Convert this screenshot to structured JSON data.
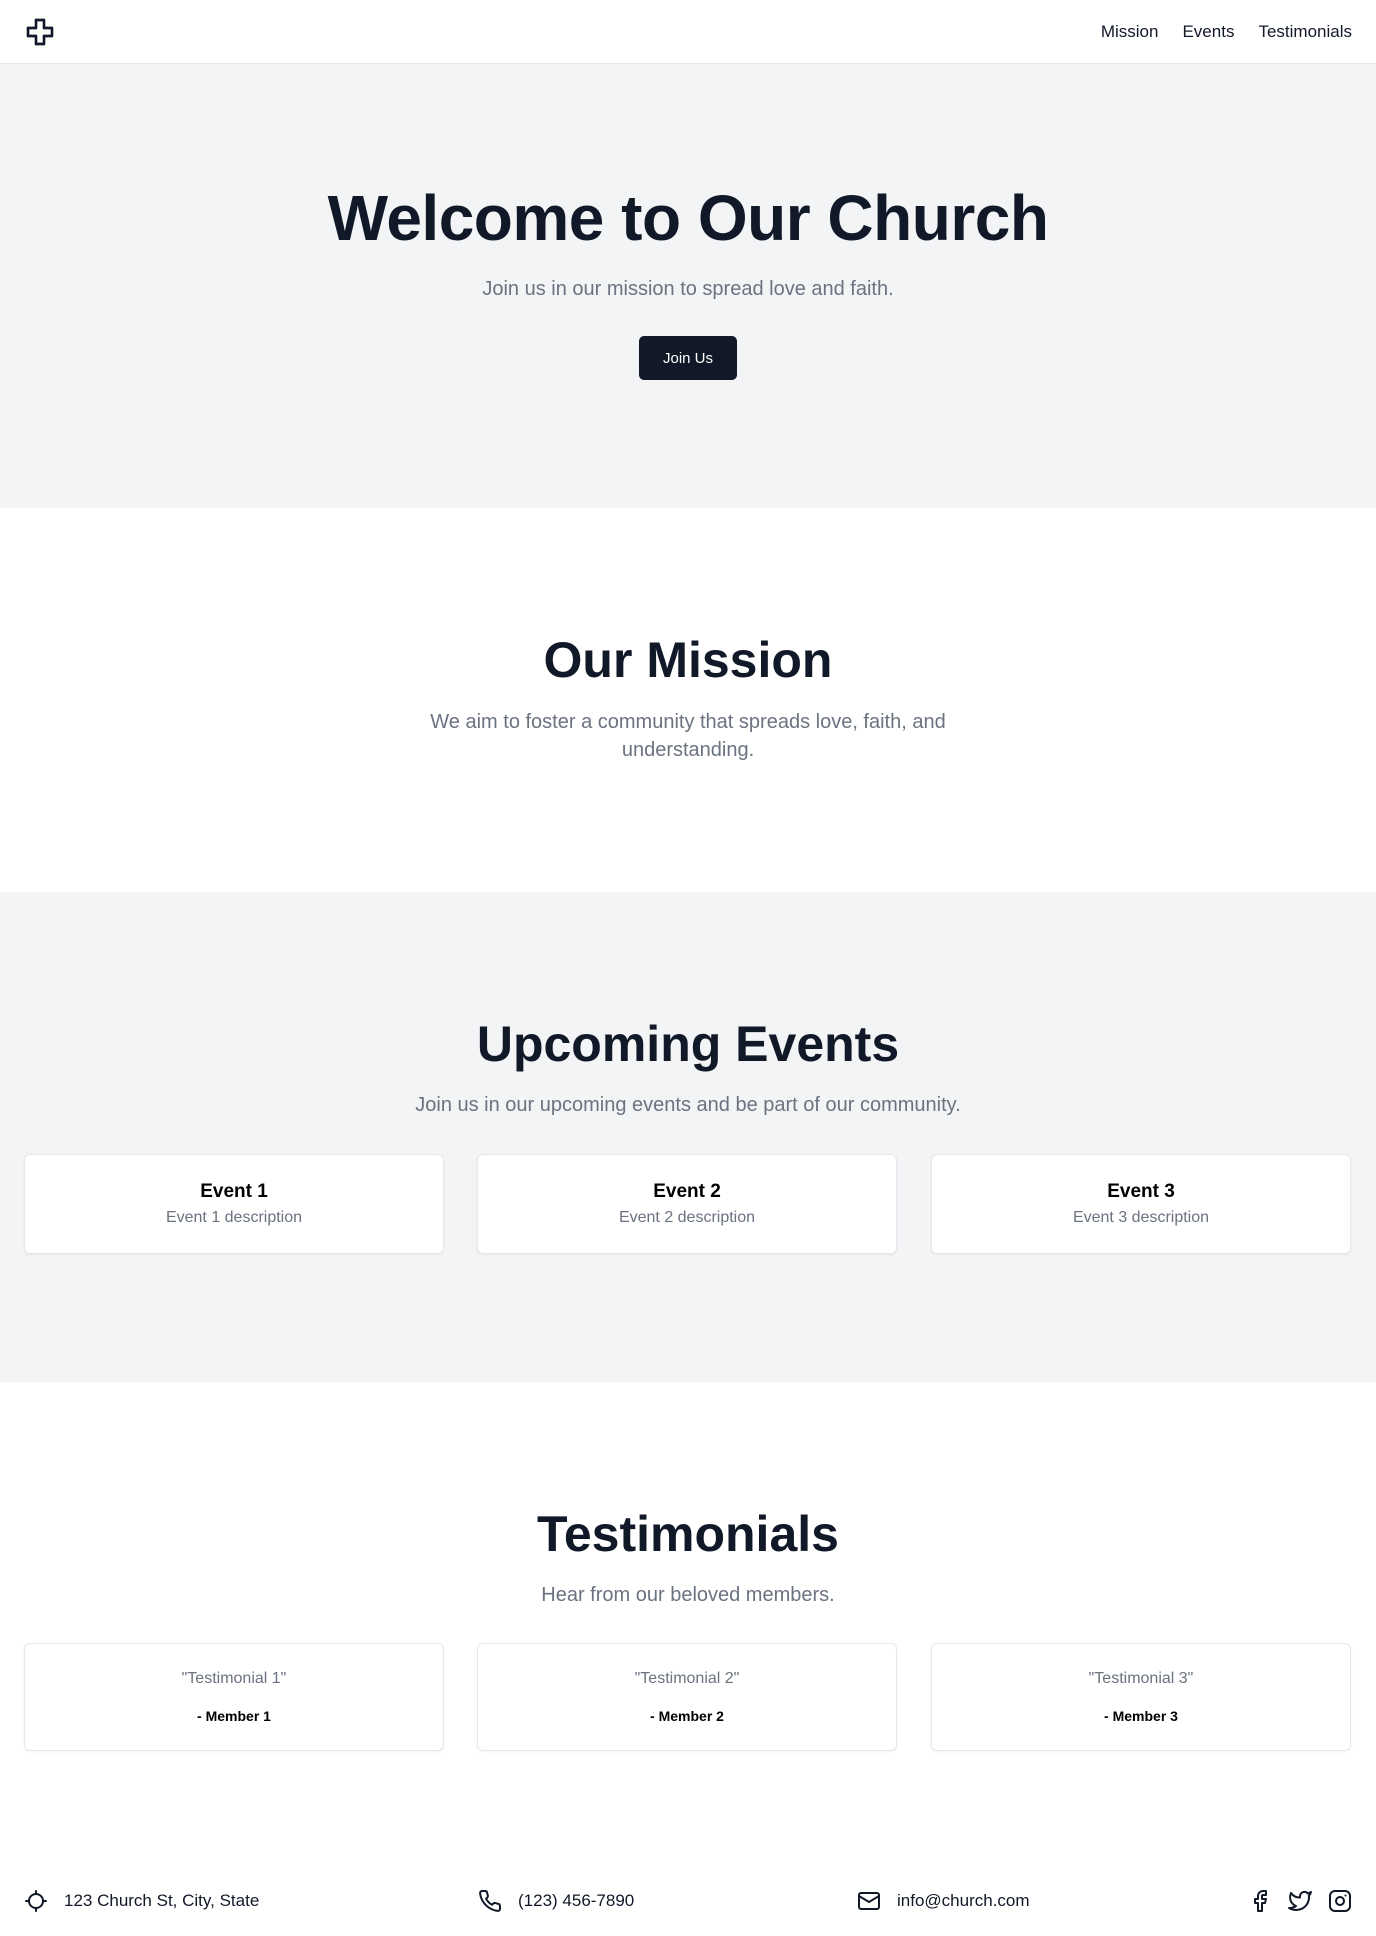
{
  "header": {
    "logo_icon": "cross-icon",
    "nav": [
      {
        "label": "Mission"
      },
      {
        "label": "Events"
      },
      {
        "label": "Testimonials"
      }
    ]
  },
  "hero": {
    "title": "Welcome to Our Church",
    "subtitle": "Join us in our mission to spread love and faith.",
    "button_label": "Join Us"
  },
  "mission": {
    "title": "Our Mission",
    "text": "We aim to foster a community that spreads love, faith, and understanding."
  },
  "events": {
    "title": "Upcoming Events",
    "subtitle": "Join us in our upcoming events and be part of our community.",
    "items": [
      {
        "title": "Event 1",
        "description": "Event 1 description"
      },
      {
        "title": "Event 2",
        "description": "Event 2 description"
      },
      {
        "title": "Event 3",
        "description": "Event 3 description"
      }
    ]
  },
  "testimonials": {
    "title": "Testimonials",
    "subtitle": "Hear from our beloved members.",
    "items": [
      {
        "quote": "\"Testimonial 1\"",
        "member": "- Member 1"
      },
      {
        "quote": "\"Testimonial 2\"",
        "member": "- Member 2"
      },
      {
        "quote": "\"Testimonial 3\"",
        "member": "- Member 3"
      }
    ]
  },
  "footer": {
    "address": "123 Church St, City, State",
    "phone": "(123) 456-7890",
    "email": "info@church.com",
    "icons": [
      "location-icon",
      "phone-icon",
      "mail-icon"
    ],
    "social": [
      "facebook-icon",
      "twitter-icon",
      "instagram-icon"
    ]
  },
  "colors": {
    "primary": "#111827",
    "muted_text": "#6b7280",
    "section_bg": "#f3f4f6",
    "border": "#e5e7eb"
  }
}
